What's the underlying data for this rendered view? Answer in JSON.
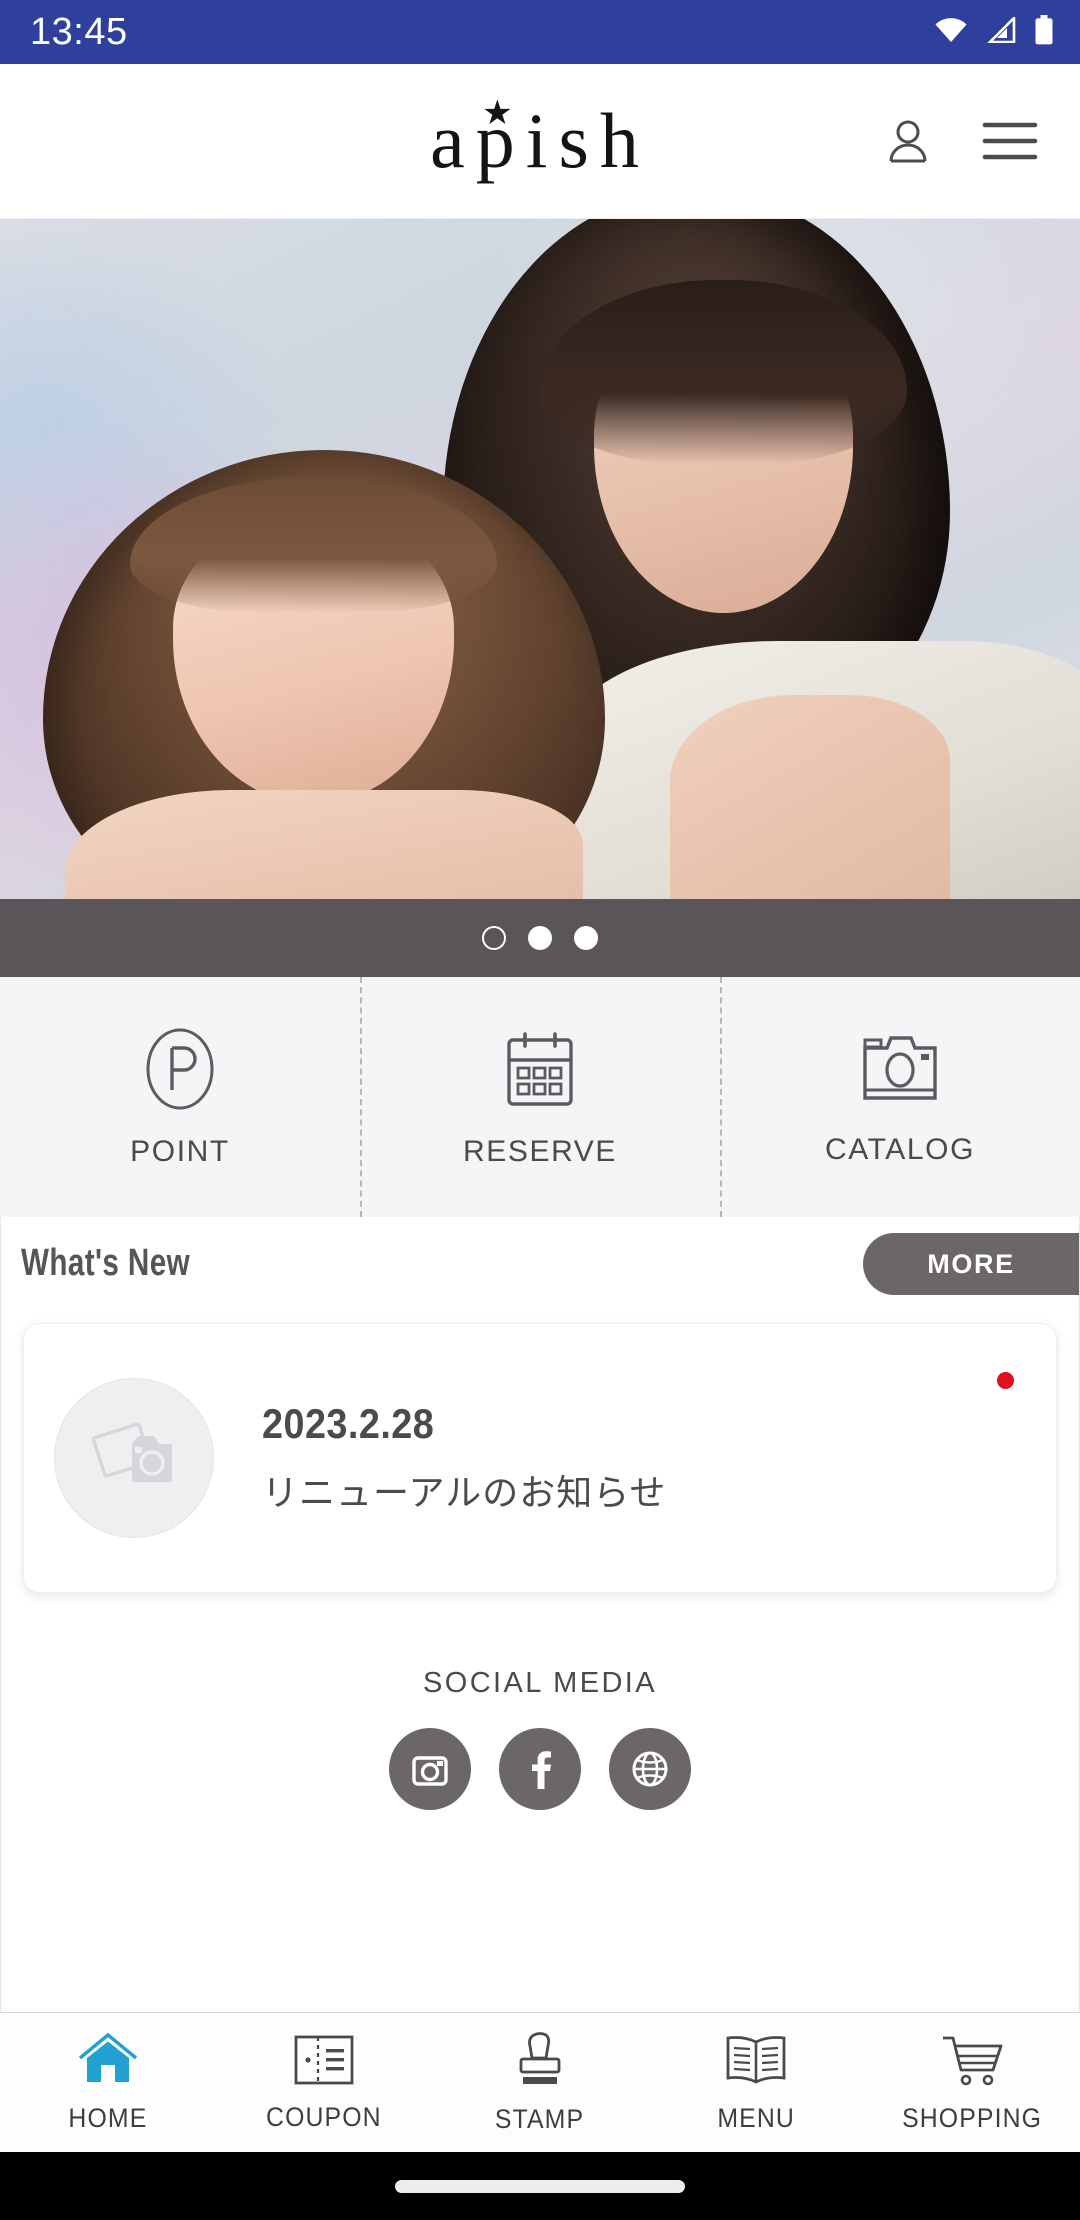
{
  "statusbar": {
    "time": "13:45",
    "icons": [
      "wifi-icon",
      "cellular-signal-icon",
      "battery-icon"
    ],
    "background": "#2F409C"
  },
  "header": {
    "logo_text": "apish",
    "logo_star": "★",
    "account_icon": "account-icon",
    "menu_icon": "hamburger-menu-icon"
  },
  "hero": {
    "alt": "two models with styled hair",
    "carousel": {
      "total": 3,
      "dots": [
        "hollow",
        "solid",
        "solid"
      ],
      "strip_color": "#5A5558"
    }
  },
  "quick_actions": [
    {
      "label": "POINT",
      "icon": "point-p-circle-icon"
    },
    {
      "label": "RESERVE",
      "icon": "calendar-icon"
    },
    {
      "label": "CATALOG",
      "icon": "camera-icon"
    }
  ],
  "whats_new": {
    "title": "What's New",
    "more_label": "MORE",
    "more_color": "#6B6668",
    "items": [
      {
        "date": "2023.2.28",
        "title": "リニューアルのお知らせ",
        "thumb_icon": "photo-placeholder-icon",
        "unread": true,
        "badge_color": "#E01020"
      }
    ]
  },
  "social": {
    "title": "SOCIAL MEDIA",
    "links": [
      {
        "name": "instagram-icon"
      },
      {
        "name": "facebook-icon"
      },
      {
        "name": "website-globe-icon"
      }
    ],
    "circle_color": "#6B6668"
  },
  "bottom_nav": {
    "active_color": "#21A0D2",
    "items": [
      {
        "label": "HOME",
        "icon": "home-icon",
        "active": true
      },
      {
        "label": "COUPON",
        "icon": "coupon-icon",
        "active": false
      },
      {
        "label": "STAMP",
        "icon": "stamp-icon",
        "active": false
      },
      {
        "label": "MENU",
        "icon": "menu-book-icon",
        "active": false
      },
      {
        "label": "SHOPPING",
        "icon": "cart-icon",
        "active": false
      }
    ]
  }
}
